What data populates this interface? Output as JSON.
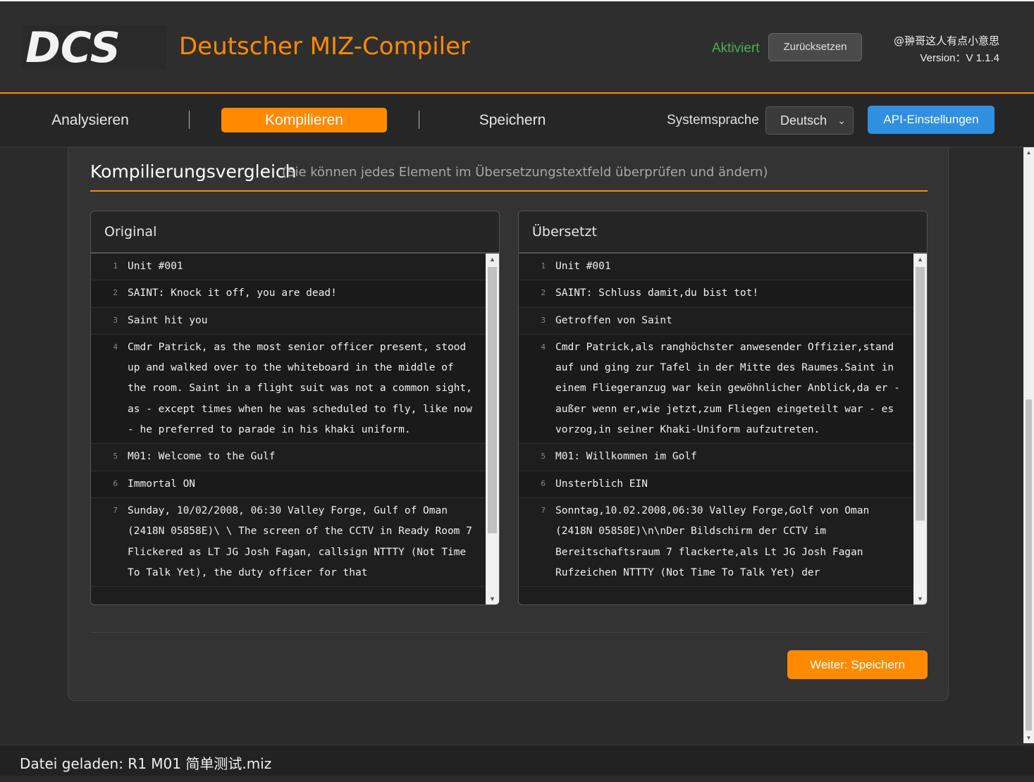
{
  "header": {
    "logo_text": "DCS",
    "title": "Deutscher MIZ-Compiler",
    "status": "Aktiviert",
    "reset_label": "Zurücksetzen",
    "author": "@翀哥这人有点小意思",
    "version": "Version：V 1.1.4"
  },
  "nav": {
    "tabs": [
      {
        "label": "Analysieren"
      },
      {
        "label": "Kompilieren"
      },
      {
        "label": "Speichern"
      }
    ],
    "active_tab": "Kompilieren",
    "language_label": "Systemsprache",
    "language_value": "Deutsch",
    "api_label": "API-Einstellungen"
  },
  "main": {
    "title": "Kompilierungsvergleich",
    "subtitle": "(Sie können jedes Element im Übersetzungstextfeld überprüfen und ändern)",
    "original": {
      "header": "Original",
      "lines": [
        {
          "n": "1",
          "text": "Unit #001"
        },
        {
          "n": "2",
          "text": "SAINT: Knock it off, you are dead!"
        },
        {
          "n": "3",
          "text": "Saint hit you"
        },
        {
          "n": "4",
          "text": "Cmdr Patrick, as the most senior officer present, stood up and walked over to the whiteboard in the middle of the room. Saint in a flight suit was not a common sight, as - except times when he was scheduled to fly, like now - he preferred to parade in his khaki uniform."
        },
        {
          "n": "5",
          "text": "M01: Welcome to the Gulf"
        },
        {
          "n": "6",
          "text": "Immortal ON"
        },
        {
          "n": "7",
          "text": "Sunday, 10/02/2008, 06:30 Valley Forge, Gulf of Oman (2418N 05858E)\\ \\ The screen of the CCTV in Ready Room 7 Flickered as LT JG Josh Fagan, callsign NTTTY (Not Time To Talk Yet), the duty officer for that"
        }
      ]
    },
    "translated": {
      "header": "Übersetzt",
      "lines": [
        {
          "n": "1",
          "text": "Unit #001"
        },
        {
          "n": "2",
          "text": "SAINT: Schluss damit,du bist tot!"
        },
        {
          "n": "3",
          "text": "Getroffen von Saint"
        },
        {
          "n": "4",
          "text": "Cmdr Patrick,als ranghöchster anwesender Offizier,stand auf und ging zur Tafel in der Mitte des Raumes.Saint in einem Fliegeranzug war kein gewöhnlicher Anblick,da er - außer wenn er,wie jetzt,zum Fliegen eingeteilt war - es vorzog,in seiner Khaki-Uniform aufzutreten."
        },
        {
          "n": "5",
          "text": "M01: Willkommen im Golf"
        },
        {
          "n": "6",
          "text": "Unsterblich EIN"
        },
        {
          "n": "7",
          "text": "Sonntag,10.02.2008,06:30 Valley Forge,Golf von Oman (2418N 05858E)\\n\\nDer Bildschirm der CCTV im Bereitschaftsraum 7 flackerte,als Lt JG Josh Fagan Rufzeichen NTTTY (Not Time To Talk Yet) der"
        }
      ]
    },
    "next_label": "Weiter: Speichern"
  },
  "footer": {
    "status": "Datei geladen: R1 M01 简单测试.miz"
  },
  "colors": {
    "accent": "#ff8a00",
    "active": "#4caf50",
    "api": "#2f8fe0"
  }
}
